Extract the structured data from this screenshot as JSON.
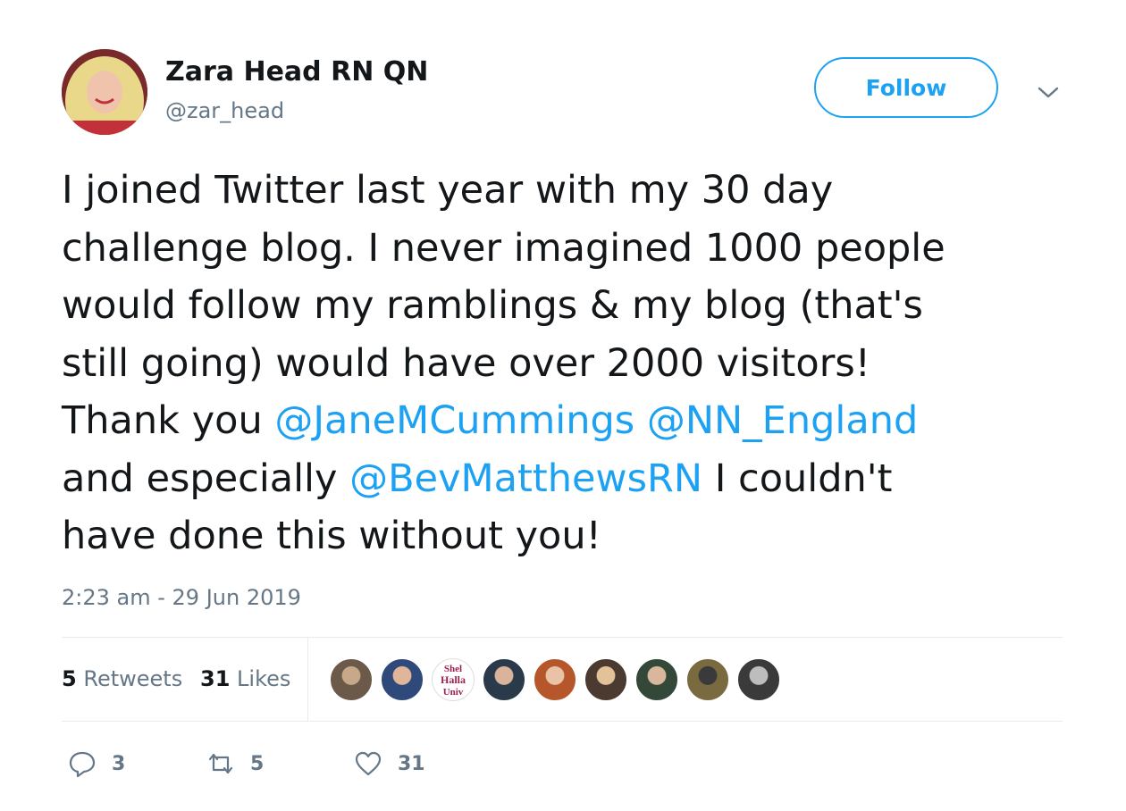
{
  "author": {
    "name": "Zara Head RN QN",
    "handle": "@zar_head"
  },
  "follow_label": "Follow",
  "tweet": {
    "lines": [
      [
        {
          "text": "I joined Twitter last year with my 30 day",
          "mention": false
        }
      ],
      [
        {
          "text": "challenge blog. I never imagined 1000 people",
          "mention": false
        }
      ],
      [
        {
          "text": "would follow my ramblings & my blog (that's",
          "mention": false
        }
      ],
      [
        {
          "text": "still going) would have over 2000 visitors!",
          "mention": false
        }
      ],
      [
        {
          "text": "Thank you ",
          "mention": false
        },
        {
          "text": "@JaneMCummings",
          "mention": true
        },
        {
          "text": " ",
          "mention": false
        },
        {
          "text": "@NN_England",
          "mention": true
        }
      ],
      [
        {
          "text": "and especially ",
          "mention": false
        },
        {
          "text": "@BevMatthewsRN",
          "mention": true
        },
        {
          "text": " I couldn't",
          "mention": false
        }
      ],
      [
        {
          "text": "have done this without you!",
          "mention": false
        }
      ]
    ]
  },
  "timestamp": "2:23 am - 29 Jun 2019",
  "stats": {
    "retweets_count": "5",
    "retweets_label": "Retweets",
    "likes_count": "31",
    "likes_label": "Likes"
  },
  "likers": [
    {
      "icon": "liker-avatar",
      "color": "#6b5a4a",
      "accent": "#c7a98a"
    },
    {
      "icon": "liker-avatar",
      "color": "#2f4a7a",
      "accent": "#e1b59a"
    },
    {
      "icon": "liker-avatar",
      "color": "#ffffff",
      "accent": "#9c1f4f",
      "text": "Shel Halla Univ"
    },
    {
      "icon": "liker-avatar",
      "color": "#2a3a4a",
      "accent": "#d9b49a"
    },
    {
      "icon": "liker-avatar",
      "color": "#b5562b",
      "accent": "#e8c3a6"
    },
    {
      "icon": "liker-avatar",
      "color": "#4a3a30",
      "accent": "#e3c29a"
    },
    {
      "icon": "liker-avatar",
      "color": "#34483a",
      "accent": "#d8b79c"
    },
    {
      "icon": "liker-avatar",
      "color": "#7a6a40",
      "accent": "#3a3a3a"
    },
    {
      "icon": "liker-avatar",
      "color": "#3a3a3a",
      "accent": "#bdbdbd"
    }
  ],
  "actions": {
    "reply_count": "3",
    "retweet_count": "5",
    "like_count": "31"
  },
  "colors": {
    "accent": "#1da1f2",
    "secondary_text": "#657786",
    "divider": "#e6ecf0"
  }
}
